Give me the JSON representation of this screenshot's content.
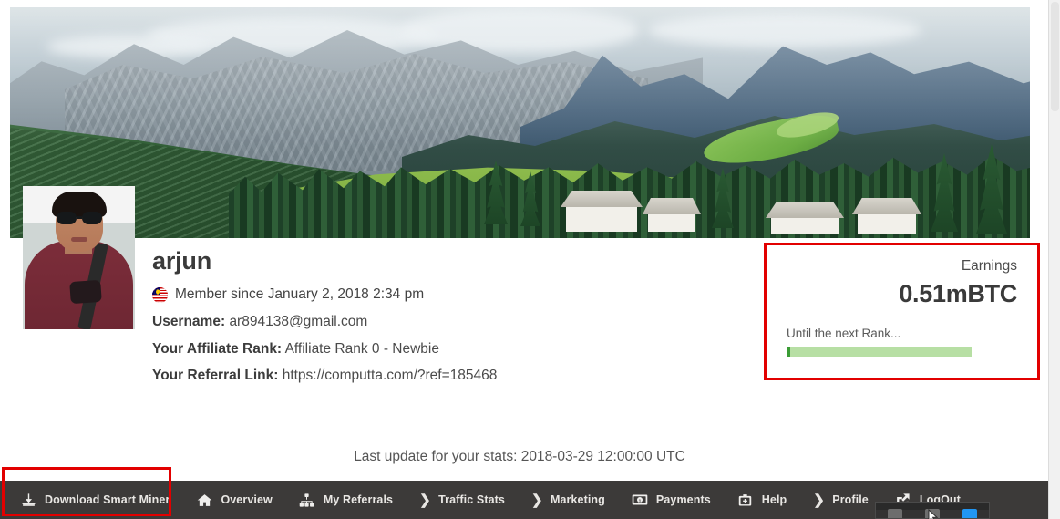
{
  "profile": {
    "display_name": "arjun",
    "flag_icon": "malaysia-flag-icon",
    "member_since": "Member since January 2, 2018 2:34 pm",
    "username_label": "Username:",
    "username_value": "ar894138@gmail.com",
    "rank_label": "Your Affiliate Rank:",
    "rank_value": "Affiliate Rank 0 - Newbie",
    "referral_label": "Your Referral Link:",
    "referral_value": "https://computta.com/?ref=185468"
  },
  "earnings": {
    "label": "Earnings",
    "amount": "0.51mBTC",
    "next_rank_label": "Until the next Rank...",
    "progress_percent": 2,
    "track_color": "#b7dfa4",
    "fill_color": "#3a9c35",
    "highlight_color": "#e20000"
  },
  "status": {
    "last_update": "Last update for your stats: 2018-03-29 12:00:00 UTC"
  },
  "nav": {
    "background_color": "#3c3a39",
    "items": [
      {
        "label": "Download Smart Miner",
        "icon": "download-icon"
      },
      {
        "label": "Overview",
        "icon": "home-icon"
      },
      {
        "label": "My Referrals",
        "icon": "sitemap-icon"
      },
      {
        "label": "Traffic Stats",
        "icon": "chevron-right-icon"
      },
      {
        "label": "Marketing",
        "icon": "chevron-right-icon"
      },
      {
        "label": "Payments",
        "icon": "banknote-icon"
      },
      {
        "label": "Help",
        "icon": "first-aid-kit-icon"
      },
      {
        "label": "Profile",
        "icon": "chevron-right-icon"
      },
      {
        "label": "LogOut",
        "icon": "share-export-icon"
      }
    ]
  },
  "banner": {
    "icon": "mountain-landscape-photo"
  },
  "avatar": {
    "icon": "user-photo"
  }
}
